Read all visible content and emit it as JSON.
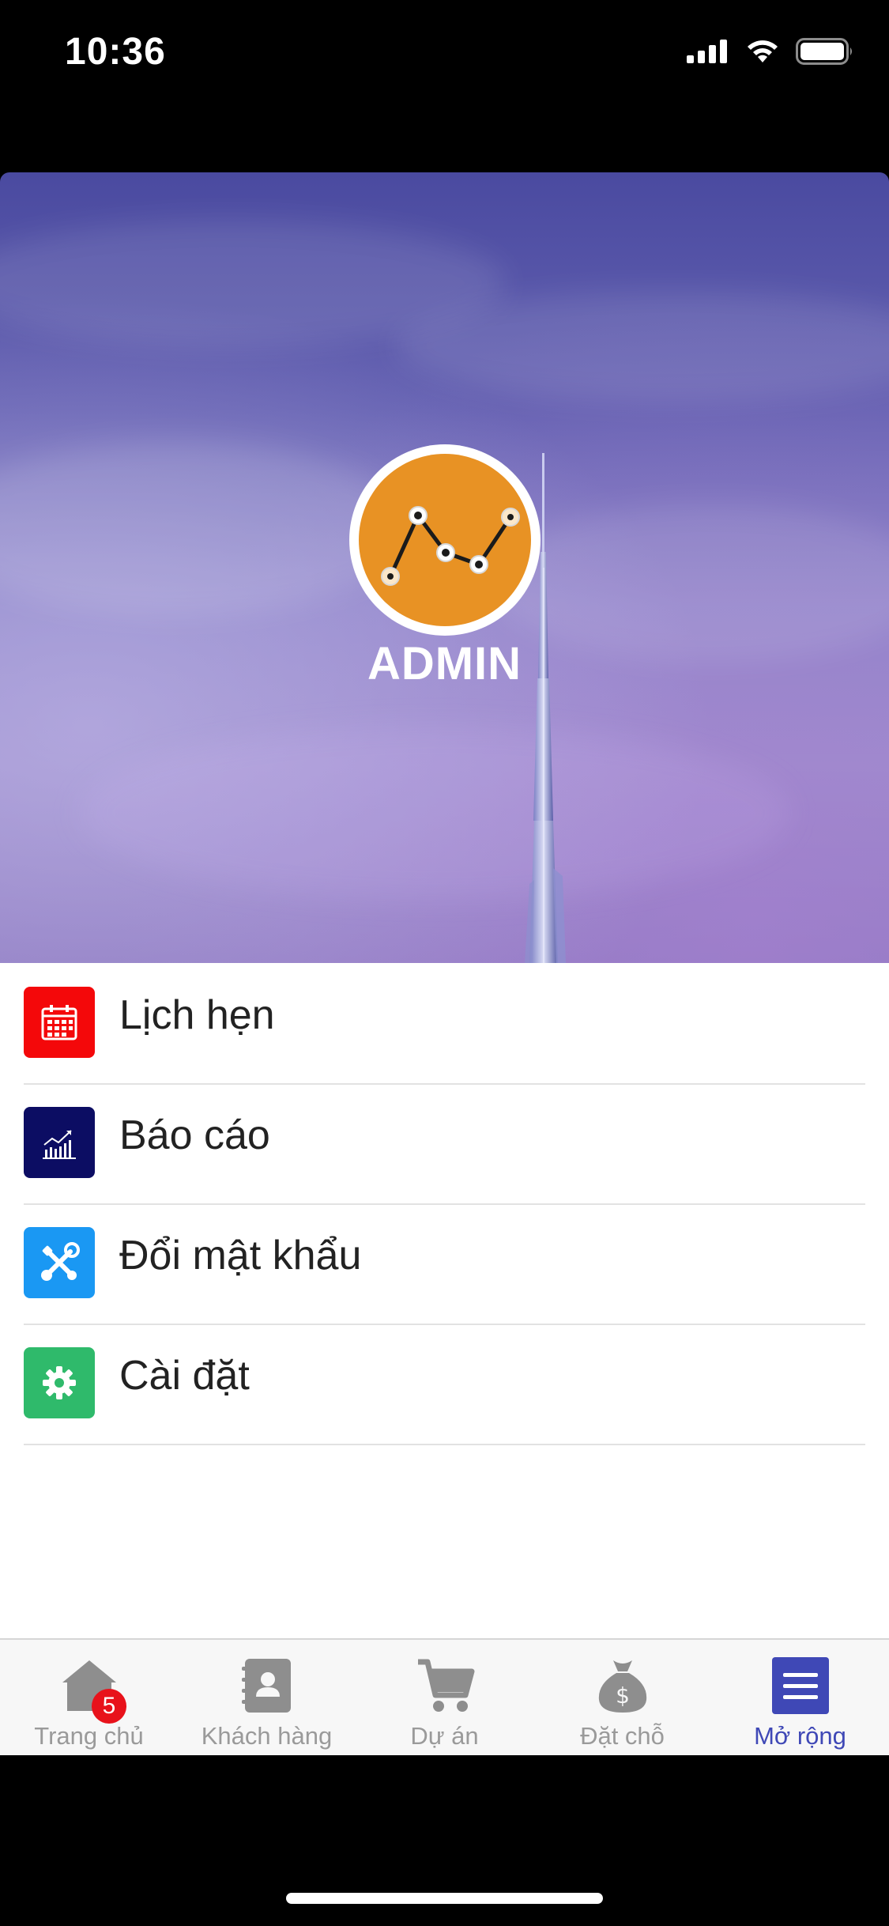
{
  "status_bar": {
    "time": "10:36"
  },
  "profile": {
    "name": "ADMIN"
  },
  "menu": {
    "items": [
      {
        "label": "Lịch hẹn",
        "icon": "calendar-icon",
        "color": "#f4080a"
      },
      {
        "label": "Báo cáo",
        "icon": "chart-icon",
        "color": "#0c0d63"
      },
      {
        "label": "Đổi mật khẩu",
        "icon": "tools-icon",
        "color": "#1a98f3"
      },
      {
        "label": "Cài đặt",
        "icon": "gear-icon",
        "color": "#2fba6b"
      }
    ]
  },
  "tabbar": {
    "items": [
      {
        "label": "Trang chủ",
        "icon": "home-icon",
        "badge": "5"
      },
      {
        "label": "Khách hàng",
        "icon": "contacts-icon"
      },
      {
        "label": "Dự án",
        "icon": "cart-icon"
      },
      {
        "label": "Đặt chỗ",
        "icon": "money-bag-icon"
      },
      {
        "label": "Mở rộng",
        "icon": "menu-icon",
        "active": true
      }
    ],
    "active_color": "#3f48b6",
    "inactive_color": "#9a9a9a"
  }
}
